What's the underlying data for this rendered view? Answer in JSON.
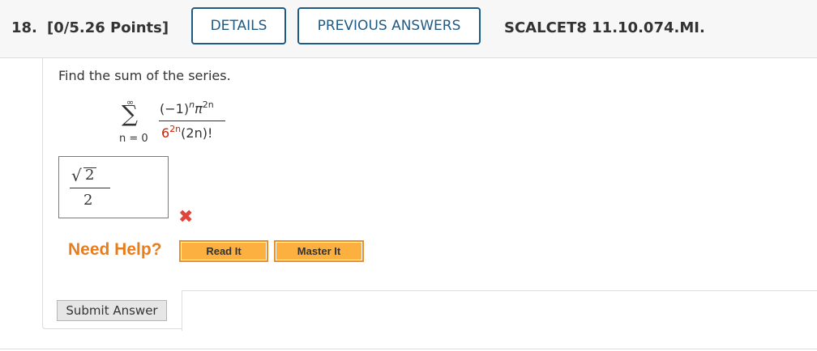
{
  "header": {
    "question_number": "18.",
    "points": "[0/5.26 Points]",
    "details_label": "DETAILS",
    "previous_answers_label": "PREVIOUS ANSWERS",
    "question_id": "SCALCET8 11.10.074.MI."
  },
  "question": {
    "prompt": "Find the sum of the series.",
    "sum_upper": "∞",
    "sum_symbol": "∑",
    "sum_lower": "n = 0",
    "numerator_base": "(−1)",
    "numerator_exp_n": "n",
    "numerator_pi": "π",
    "numerator_exp_2n": "2n",
    "denominator_base": "6",
    "denominator_exp": "2n",
    "denominator_rest": "(2n)!",
    "highlight_color": "#cc2200"
  },
  "answer": {
    "numerator": "2",
    "radical": "√",
    "denominator": "2",
    "status_icon": "wrong-x-icon",
    "status_mark": "✖",
    "status_color": "#e0443a"
  },
  "help": {
    "label": "Need Help?",
    "read_it_label": "Read It",
    "master_it_label": "Master It"
  },
  "submit": {
    "label": "Submit Answer"
  }
}
